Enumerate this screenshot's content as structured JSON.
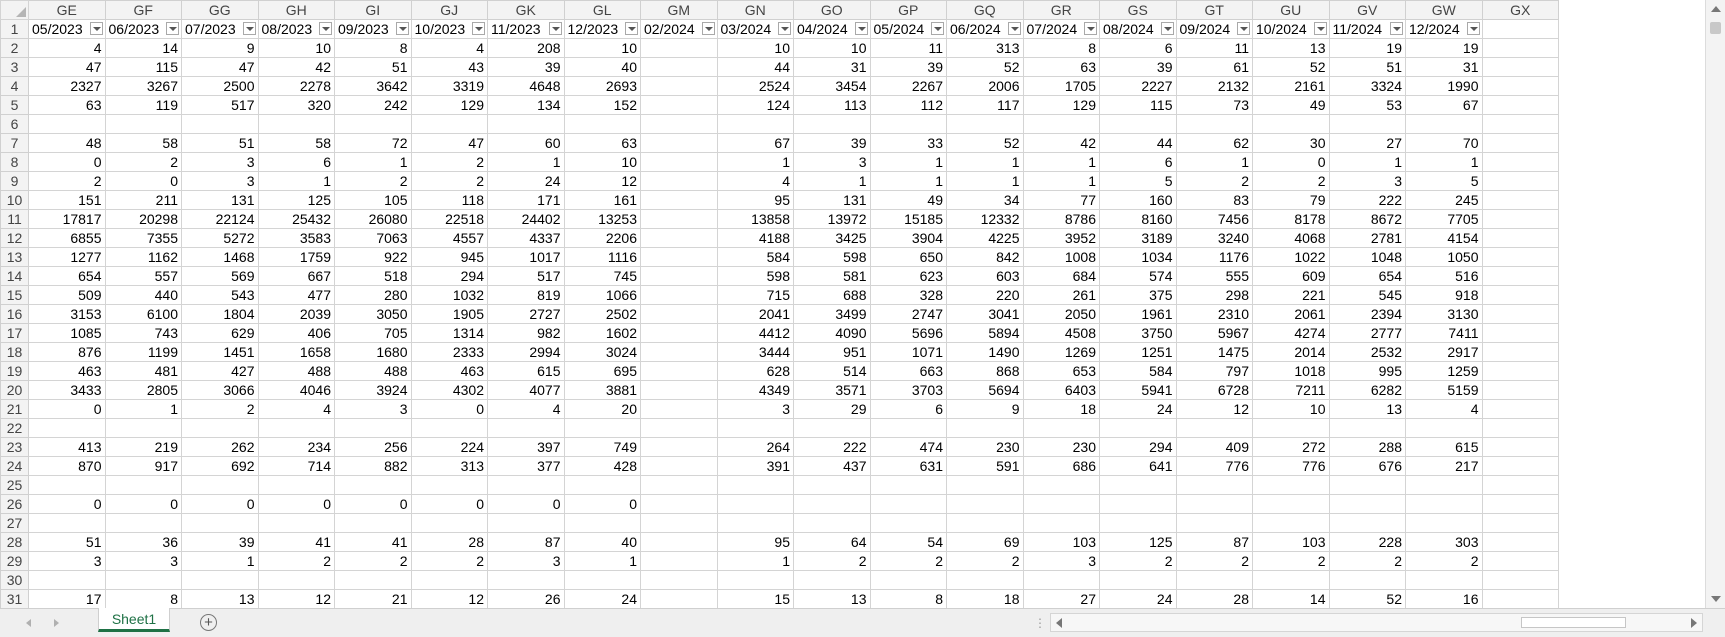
{
  "sheet": {
    "columns": [
      "GE",
      "GF",
      "GG",
      "GH",
      "GI",
      "GJ",
      "GK",
      "GL",
      "GM",
      "GN",
      "GO",
      "GP",
      "GQ",
      "GR",
      "GS",
      "GT",
      "GU",
      "GV",
      "GW",
      "GX"
    ],
    "headers": [
      "05/2023",
      "06/2023",
      "07/2023",
      "08/2023",
      "09/2023",
      "10/2023",
      "11/2023",
      "12/2023",
      "02/2024",
      "03/2024",
      "04/2024",
      "05/2024",
      "06/2024",
      "07/2024",
      "08/2024",
      "09/2024",
      "10/2024",
      "11/2024",
      "12/2024",
      ""
    ],
    "rows": [
      {
        "n": "2",
        "cells": [
          "4",
          "14",
          "9",
          "10",
          "8",
          "4",
          "208",
          "10",
          "",
          "10",
          "10",
          "11",
          "313",
          "8",
          "6",
          "11",
          "13",
          "19",
          "19",
          ""
        ]
      },
      {
        "n": "3",
        "cells": [
          "47",
          "115",
          "47",
          "42",
          "51",
          "43",
          "39",
          "40",
          "",
          "44",
          "31",
          "39",
          "52",
          "63",
          "39",
          "61",
          "52",
          "51",
          "31",
          ""
        ]
      },
      {
        "n": "4",
        "cells": [
          "2327",
          "3267",
          "2500",
          "2278",
          "3642",
          "3319",
          "4648",
          "2693",
          "",
          "2524",
          "3454",
          "2267",
          "2006",
          "1705",
          "2227",
          "2132",
          "2161",
          "3324",
          "1990",
          ""
        ]
      },
      {
        "n": "5",
        "cells": [
          "63",
          "119",
          "517",
          "320",
          "242",
          "129",
          "134",
          "152",
          "",
          "124",
          "113",
          "112",
          "117",
          "129",
          "115",
          "73",
          "49",
          "53",
          "67",
          ""
        ]
      },
      {
        "n": "6",
        "cells": [
          "",
          "",
          "",
          "",
          "",
          "",
          "",
          "",
          "",
          "",
          "",
          "",
          "",
          "",
          "",
          "",
          "",
          "",
          "",
          ""
        ]
      },
      {
        "n": "7",
        "cells": [
          "48",
          "58",
          "51",
          "58",
          "72",
          "47",
          "60",
          "63",
          "",
          "67",
          "39",
          "33",
          "52",
          "42",
          "44",
          "62",
          "30",
          "27",
          "70",
          ""
        ]
      },
      {
        "n": "8",
        "cells": [
          "0",
          "2",
          "3",
          "6",
          "1",
          "2",
          "1",
          "10",
          "",
          "1",
          "3",
          "1",
          "1",
          "1",
          "6",
          "1",
          "0",
          "1",
          "1",
          ""
        ]
      },
      {
        "n": "9",
        "cells": [
          "2",
          "0",
          "3",
          "1",
          "2",
          "2",
          "24",
          "12",
          "",
          "4",
          "1",
          "1",
          "1",
          "1",
          "5",
          "2",
          "2",
          "3",
          "5",
          ""
        ]
      },
      {
        "n": "10",
        "cells": [
          "151",
          "211",
          "131",
          "125",
          "105",
          "118",
          "171",
          "161",
          "",
          "95",
          "131",
          "49",
          "34",
          "77",
          "160",
          "83",
          "79",
          "222",
          "245",
          ""
        ]
      },
      {
        "n": "11",
        "cells": [
          "17817",
          "20298",
          "22124",
          "25432",
          "26080",
          "22518",
          "24402",
          "13253",
          "",
          "13858",
          "13972",
          "15185",
          "12332",
          "8786",
          "8160",
          "7456",
          "8178",
          "8672",
          "7705",
          ""
        ]
      },
      {
        "n": "12",
        "cells": [
          "6855",
          "7355",
          "5272",
          "3583",
          "7063",
          "4557",
          "4337",
          "2206",
          "",
          "4188",
          "3425",
          "3904",
          "4225",
          "3952",
          "3189",
          "3240",
          "4068",
          "2781",
          "4154",
          ""
        ]
      },
      {
        "n": "13",
        "cells": [
          "1277",
          "1162",
          "1468",
          "1759",
          "922",
          "945",
          "1017",
          "1116",
          "",
          "584",
          "598",
          "650",
          "842",
          "1008",
          "1034",
          "1176",
          "1022",
          "1048",
          "1050",
          ""
        ]
      },
      {
        "n": "14",
        "cells": [
          "654",
          "557",
          "569",
          "667",
          "518",
          "294",
          "517",
          "745",
          "",
          "598",
          "581",
          "623",
          "603",
          "684",
          "574",
          "555",
          "609",
          "654",
          "516",
          ""
        ]
      },
      {
        "n": "15",
        "cells": [
          "509",
          "440",
          "543",
          "477",
          "280",
          "1032",
          "819",
          "1066",
          "",
          "715",
          "688",
          "328",
          "220",
          "261",
          "375",
          "298",
          "221",
          "545",
          "918",
          ""
        ]
      },
      {
        "n": "16",
        "cells": [
          "3153",
          "6100",
          "1804",
          "2039",
          "3050",
          "1905",
          "2727",
          "2502",
          "",
          "2041",
          "3499",
          "2747",
          "3041",
          "2050",
          "1961",
          "2310",
          "2061",
          "2394",
          "3130",
          ""
        ]
      },
      {
        "n": "17",
        "cells": [
          "1085",
          "743",
          "629",
          "406",
          "705",
          "1314",
          "982",
          "1602",
          "",
          "4412",
          "4090",
          "5696",
          "5894",
          "4508",
          "3750",
          "5967",
          "4274",
          "2777",
          "7411",
          ""
        ]
      },
      {
        "n": "18",
        "cells": [
          "876",
          "1199",
          "1451",
          "1658",
          "1680",
          "2333",
          "2994",
          "3024",
          "",
          "3444",
          "951",
          "1071",
          "1490",
          "1269",
          "1251",
          "1475",
          "2014",
          "2532",
          "2917",
          ""
        ]
      },
      {
        "n": "19",
        "cells": [
          "463",
          "481",
          "427",
          "488",
          "488",
          "463",
          "615",
          "695",
          "",
          "628",
          "514",
          "663",
          "868",
          "653",
          "584",
          "797",
          "1018",
          "995",
          "1259",
          ""
        ]
      },
      {
        "n": "20",
        "cells": [
          "3433",
          "2805",
          "3066",
          "4046",
          "3924",
          "4302",
          "4077",
          "3881",
          "",
          "4349",
          "3571",
          "3703",
          "5694",
          "6403",
          "5941",
          "6728",
          "7211",
          "6282",
          "5159",
          ""
        ]
      },
      {
        "n": "21",
        "cells": [
          "0",
          "1",
          "2",
          "4",
          "3",
          "0",
          "4",
          "20",
          "",
          "3",
          "29",
          "6",
          "9",
          "18",
          "24",
          "12",
          "10",
          "13",
          "4",
          ""
        ]
      },
      {
        "n": "22",
        "cells": [
          "",
          "",
          "",
          "",
          "",
          "",
          "",
          "",
          "",
          "",
          "",
          "",
          "",
          "",
          "",
          "",
          "",
          "",
          "",
          ""
        ]
      },
      {
        "n": "23",
        "cells": [
          "413",
          "219",
          "262",
          "234",
          "256",
          "224",
          "397",
          "749",
          "",
          "264",
          "222",
          "474",
          "230",
          "230",
          "294",
          "409",
          "272",
          "288",
          "615",
          ""
        ]
      },
      {
        "n": "24",
        "cells": [
          "870",
          "917",
          "692",
          "714",
          "882",
          "313",
          "377",
          "428",
          "",
          "391",
          "437",
          "631",
          "591",
          "686",
          "641",
          "776",
          "776",
          "676",
          "217",
          ""
        ]
      },
      {
        "n": "25",
        "cells": [
          "",
          "",
          "",
          "",
          "",
          "",
          "",
          "",
          "",
          "",
          "",
          "",
          "",
          "",
          "",
          "",
          "",
          "",
          "",
          ""
        ]
      },
      {
        "n": "26",
        "cells": [
          "0",
          "0",
          "0",
          "0",
          "0",
          "0",
          "0",
          "0",
          "",
          "",
          "",
          "",
          "",
          "",
          "",
          "",
          "",
          "",
          "",
          ""
        ]
      },
      {
        "n": "27",
        "cells": [
          "",
          "",
          "",
          "",
          "",
          "",
          "",
          "",
          "",
          "",
          "",
          "",
          "",
          "",
          "",
          "",
          "",
          "",
          "",
          ""
        ]
      },
      {
        "n": "28",
        "cells": [
          "51",
          "36",
          "39",
          "41",
          "41",
          "28",
          "87",
          "40",
          "",
          "95",
          "64",
          "54",
          "69",
          "103",
          "125",
          "87",
          "103",
          "228",
          "303",
          ""
        ]
      },
      {
        "n": "29",
        "cells": [
          "3",
          "3",
          "1",
          "2",
          "2",
          "2",
          "3",
          "1",
          "",
          "1",
          "2",
          "2",
          "2",
          "3",
          "2",
          "2",
          "2",
          "2",
          "2",
          ""
        ]
      },
      {
        "n": "30",
        "cells": [
          "",
          "",
          "",
          "",
          "",
          "",
          "",
          "",
          "",
          "",
          "",
          "",
          "",
          "",
          "",
          "",
          "",
          "",
          "",
          ""
        ]
      },
      {
        "n": "31",
        "cells": [
          "17",
          "8",
          "13",
          "12",
          "21",
          "12",
          "26",
          "24",
          "",
          "15",
          "13",
          "8",
          "18",
          "27",
          "24",
          "28",
          "14",
          "52",
          "16",
          ""
        ]
      }
    ]
  },
  "tabs": {
    "active": "Sheet1",
    "add_symbol": "+",
    "splitter": "⋮"
  },
  "colors": {
    "accent": "#1e7145",
    "header_bg": "#f3f3f3",
    "gridline": "#d4d4d4"
  }
}
